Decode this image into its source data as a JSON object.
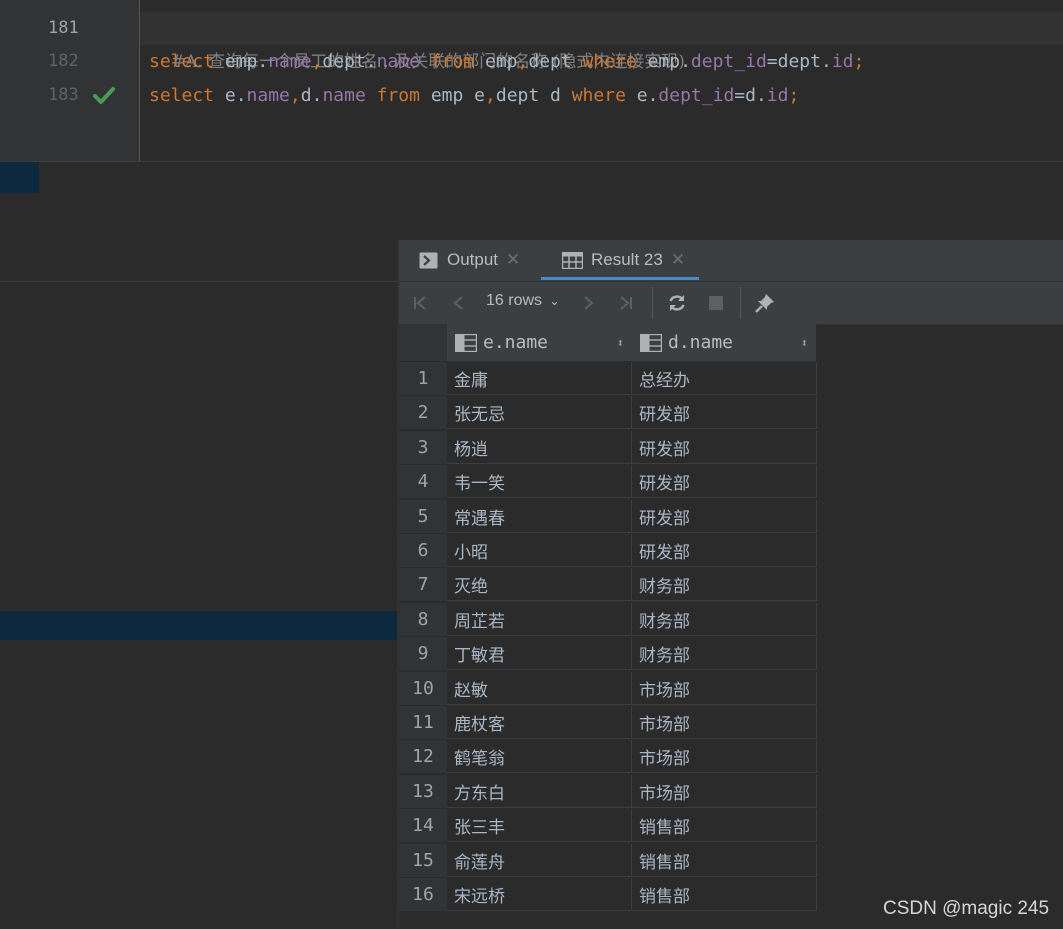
{
  "editor": {
    "lines": [
      {
        "number": "181",
        "comment": "#A. 查询每一个员工的姓名 , 及关联的部门的名称 (隐式内连接实现)"
      },
      {
        "number": "182"
      },
      {
        "number": "183"
      }
    ],
    "line182": {
      "kw1": "select",
      "t1": " emp.",
      "f1": "name",
      "p1": ",",
      "t2": "dept.",
      "f2": "name",
      "kw2": " from",
      "t3": " emp",
      "p2": ",",
      "t4": "dept ",
      "kw3": "where",
      "t5": " emp.",
      "f3": "dept_id",
      "t6": "=dept.",
      "f4": "id",
      "p3": ";"
    },
    "line183": {
      "kw1": "select",
      "t1": " e.",
      "f1": "name",
      "p1": ",",
      "t2": "d.",
      "f2": "name",
      "kw2": " from",
      "t3": " emp e",
      "p2": ",",
      "t4": "dept d ",
      "kw3": "where",
      "t5": " e.",
      "f3": "dept_id",
      "t6": "=d.",
      "f4": "id",
      "p3": ";"
    },
    "status_icon": "check-icon"
  },
  "tabs": [
    {
      "label": "Output",
      "icon": "console-icon"
    },
    {
      "label": "Result 23",
      "icon": "table-icon",
      "active": true
    }
  ],
  "toolbar": {
    "rows_label": "16 rows",
    "icons": [
      "first-page-icon",
      "prev-page-icon",
      "next-page-icon",
      "last-page-icon",
      "refresh-icon",
      "stop-icon",
      "pin-icon"
    ]
  },
  "grid": {
    "columns": [
      "e.name",
      "d.name"
    ],
    "rows": [
      [
        "1",
        "金庸",
        "总经办"
      ],
      [
        "2",
        "张无忌",
        "研发部"
      ],
      [
        "3",
        "杨逍",
        "研发部"
      ],
      [
        "4",
        "韦一笑",
        "研发部"
      ],
      [
        "5",
        "常遇春",
        "研发部"
      ],
      [
        "6",
        "小昭",
        "研发部"
      ],
      [
        "7",
        "灭绝",
        "财务部"
      ],
      [
        "8",
        "周芷若",
        "财务部"
      ],
      [
        "9",
        "丁敏君",
        "财务部"
      ],
      [
        "10",
        "赵敏",
        "市场部"
      ],
      [
        "11",
        "鹿杖客",
        "市场部"
      ],
      [
        "12",
        "鹤笔翁",
        "市场部"
      ],
      [
        "13",
        "方东白",
        "市场部"
      ],
      [
        "14",
        "张三丰",
        "销售部"
      ],
      [
        "15",
        "俞莲舟",
        "销售部"
      ],
      [
        "16",
        "宋远桥",
        "销售部"
      ]
    ]
  },
  "watermark": "CSDN @magic 245",
  "colors": {
    "keyword": "#cc7832",
    "field": "#9876aa",
    "text": "#a9b7c6",
    "comment": "#808080",
    "check": "#499c54",
    "accent": "#4a88c7"
  }
}
